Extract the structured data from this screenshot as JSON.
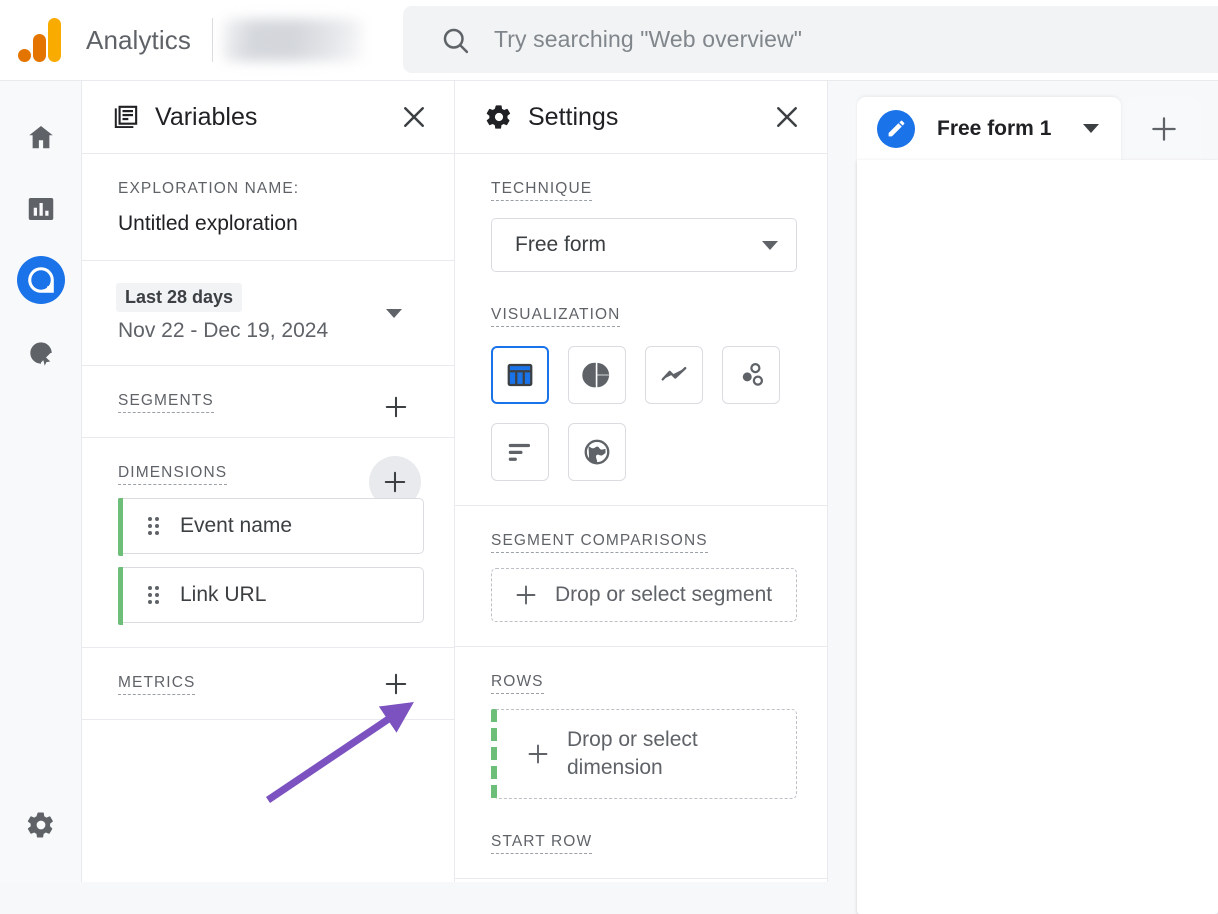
{
  "topbar": {
    "brand": "Analytics",
    "logo_icon": "google-analytics-logo",
    "property_selector": "",
    "search": {
      "icon": "search-icon",
      "placeholder": "Try searching \"Web overview\"",
      "value": ""
    }
  },
  "rail": {
    "items": [
      {
        "icon": "home-icon",
        "name": "home",
        "active": false
      },
      {
        "icon": "bar-chart-icon",
        "name": "reports",
        "active": false
      },
      {
        "icon": "explore-icon",
        "name": "explore",
        "active": true
      },
      {
        "icon": "advertising-target-icon",
        "name": "advertising",
        "active": false
      }
    ],
    "admin": {
      "icon": "gear-icon",
      "name": "admin"
    }
  },
  "variables_panel": {
    "icon": "variables-list-icon",
    "title": "Variables",
    "close_icon": "close-icon",
    "exploration_name_label": "EXPLORATION NAME:",
    "exploration_name_value": "Untitled exploration",
    "date_range": {
      "chip": "Last 28 days",
      "range": "Nov 22 - Dec 19, 2024",
      "caret_icon": "chevron-down-icon"
    },
    "segments": {
      "label": "SEGMENTS",
      "add_icon": "plus-icon",
      "items": []
    },
    "dimensions": {
      "label": "DIMENSIONS",
      "add_icon": "plus-icon",
      "items": [
        {
          "label": "Event name",
          "handle_icon": "drag-handle-icon"
        },
        {
          "label": "Link URL",
          "handle_icon": "drag-handle-icon"
        }
      ]
    },
    "metrics": {
      "label": "METRICS",
      "add_icon": "plus-icon",
      "items": []
    }
  },
  "settings_panel": {
    "icon": "gear-icon",
    "title": "Settings",
    "close_icon": "close-icon",
    "technique": {
      "label": "TECHNIQUE",
      "selected": "Free form",
      "caret_icon": "chevron-down-icon"
    },
    "visualization": {
      "label": "VISUALIZATION",
      "options": [
        {
          "icon": "table-icon",
          "name": "free-form-table",
          "selected": true
        },
        {
          "icon": "donut-chart-icon",
          "name": "donut-chart",
          "selected": false
        },
        {
          "icon": "line-chart-icon",
          "name": "line-chart",
          "selected": false
        },
        {
          "icon": "scatter-plot-icon",
          "name": "scatter-plot",
          "selected": false
        },
        {
          "icon": "horizontal-bar-icon",
          "name": "bar-chart",
          "selected": false
        },
        {
          "icon": "globe-icon",
          "name": "geo-map",
          "selected": false
        }
      ]
    },
    "segment_comparisons": {
      "label": "SEGMENT COMPARISONS",
      "dropzone_text": "Drop or select segment",
      "plus_icon": "plus-icon"
    },
    "rows": {
      "label": "ROWS",
      "dropzone_text": "Drop or select dimension",
      "plus_icon": "plus-icon"
    },
    "start_row": {
      "label": "START ROW"
    }
  },
  "canvas": {
    "tab": {
      "icon": "edit-pencil-icon",
      "label": "Free form 1",
      "caret_icon": "chevron-down-icon"
    },
    "add_tab_icon": "plus-icon"
  },
  "annotation": {
    "type": "arrow",
    "color": "#7B52BF",
    "points_to": "metrics-add-button"
  },
  "colors": {
    "accent_blue": "#1A73E8",
    "dimension_green": "#6DBE79",
    "logo_amber": "#F9AB00",
    "logo_orange": "#E37400",
    "annotation_purple": "#7B52BF",
    "text_primary": "#202124",
    "text_secondary": "#5F6368",
    "border": "#DADCE0",
    "page_bg": "#F6F8FA"
  }
}
